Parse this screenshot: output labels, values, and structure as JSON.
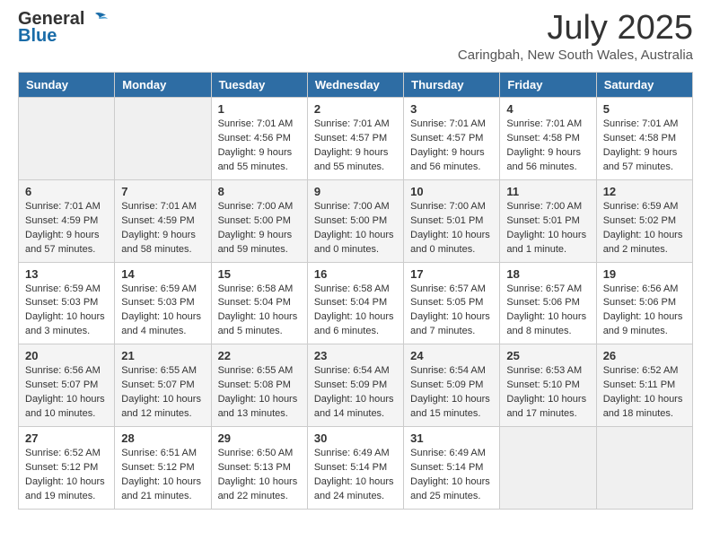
{
  "header": {
    "logo_general": "General",
    "logo_blue": "Blue",
    "month_year": "July 2025",
    "location": "Caringbah, New South Wales, Australia"
  },
  "weekdays": [
    "Sunday",
    "Monday",
    "Tuesday",
    "Wednesday",
    "Thursday",
    "Friday",
    "Saturday"
  ],
  "weeks": [
    [
      {
        "day": "",
        "info": ""
      },
      {
        "day": "",
        "info": ""
      },
      {
        "day": "1",
        "info": "Sunrise: 7:01 AM\nSunset: 4:56 PM\nDaylight: 9 hours\nand 55 minutes."
      },
      {
        "day": "2",
        "info": "Sunrise: 7:01 AM\nSunset: 4:57 PM\nDaylight: 9 hours\nand 55 minutes."
      },
      {
        "day": "3",
        "info": "Sunrise: 7:01 AM\nSunset: 4:57 PM\nDaylight: 9 hours\nand 56 minutes."
      },
      {
        "day": "4",
        "info": "Sunrise: 7:01 AM\nSunset: 4:58 PM\nDaylight: 9 hours\nand 56 minutes."
      },
      {
        "day": "5",
        "info": "Sunrise: 7:01 AM\nSunset: 4:58 PM\nDaylight: 9 hours\nand 57 minutes."
      }
    ],
    [
      {
        "day": "6",
        "info": "Sunrise: 7:01 AM\nSunset: 4:59 PM\nDaylight: 9 hours\nand 57 minutes."
      },
      {
        "day": "7",
        "info": "Sunrise: 7:01 AM\nSunset: 4:59 PM\nDaylight: 9 hours\nand 58 minutes."
      },
      {
        "day": "8",
        "info": "Sunrise: 7:00 AM\nSunset: 5:00 PM\nDaylight: 9 hours\nand 59 minutes."
      },
      {
        "day": "9",
        "info": "Sunrise: 7:00 AM\nSunset: 5:00 PM\nDaylight: 10 hours\nand 0 minutes."
      },
      {
        "day": "10",
        "info": "Sunrise: 7:00 AM\nSunset: 5:01 PM\nDaylight: 10 hours\nand 0 minutes."
      },
      {
        "day": "11",
        "info": "Sunrise: 7:00 AM\nSunset: 5:01 PM\nDaylight: 10 hours\nand 1 minute."
      },
      {
        "day": "12",
        "info": "Sunrise: 6:59 AM\nSunset: 5:02 PM\nDaylight: 10 hours\nand 2 minutes."
      }
    ],
    [
      {
        "day": "13",
        "info": "Sunrise: 6:59 AM\nSunset: 5:03 PM\nDaylight: 10 hours\nand 3 minutes."
      },
      {
        "day": "14",
        "info": "Sunrise: 6:59 AM\nSunset: 5:03 PM\nDaylight: 10 hours\nand 4 minutes."
      },
      {
        "day": "15",
        "info": "Sunrise: 6:58 AM\nSunset: 5:04 PM\nDaylight: 10 hours\nand 5 minutes."
      },
      {
        "day": "16",
        "info": "Sunrise: 6:58 AM\nSunset: 5:04 PM\nDaylight: 10 hours\nand 6 minutes."
      },
      {
        "day": "17",
        "info": "Sunrise: 6:57 AM\nSunset: 5:05 PM\nDaylight: 10 hours\nand 7 minutes."
      },
      {
        "day": "18",
        "info": "Sunrise: 6:57 AM\nSunset: 5:06 PM\nDaylight: 10 hours\nand 8 minutes."
      },
      {
        "day": "19",
        "info": "Sunrise: 6:56 AM\nSunset: 5:06 PM\nDaylight: 10 hours\nand 9 minutes."
      }
    ],
    [
      {
        "day": "20",
        "info": "Sunrise: 6:56 AM\nSunset: 5:07 PM\nDaylight: 10 hours\nand 10 minutes."
      },
      {
        "day": "21",
        "info": "Sunrise: 6:55 AM\nSunset: 5:07 PM\nDaylight: 10 hours\nand 12 minutes."
      },
      {
        "day": "22",
        "info": "Sunrise: 6:55 AM\nSunset: 5:08 PM\nDaylight: 10 hours\nand 13 minutes."
      },
      {
        "day": "23",
        "info": "Sunrise: 6:54 AM\nSunset: 5:09 PM\nDaylight: 10 hours\nand 14 minutes."
      },
      {
        "day": "24",
        "info": "Sunrise: 6:54 AM\nSunset: 5:09 PM\nDaylight: 10 hours\nand 15 minutes."
      },
      {
        "day": "25",
        "info": "Sunrise: 6:53 AM\nSunset: 5:10 PM\nDaylight: 10 hours\nand 17 minutes."
      },
      {
        "day": "26",
        "info": "Sunrise: 6:52 AM\nSunset: 5:11 PM\nDaylight: 10 hours\nand 18 minutes."
      }
    ],
    [
      {
        "day": "27",
        "info": "Sunrise: 6:52 AM\nSunset: 5:12 PM\nDaylight: 10 hours\nand 19 minutes."
      },
      {
        "day": "28",
        "info": "Sunrise: 6:51 AM\nSunset: 5:12 PM\nDaylight: 10 hours\nand 21 minutes."
      },
      {
        "day": "29",
        "info": "Sunrise: 6:50 AM\nSunset: 5:13 PM\nDaylight: 10 hours\nand 22 minutes."
      },
      {
        "day": "30",
        "info": "Sunrise: 6:49 AM\nSunset: 5:14 PM\nDaylight: 10 hours\nand 24 minutes."
      },
      {
        "day": "31",
        "info": "Sunrise: 6:49 AM\nSunset: 5:14 PM\nDaylight: 10 hours\nand 25 minutes."
      },
      {
        "day": "",
        "info": ""
      },
      {
        "day": "",
        "info": ""
      }
    ]
  ]
}
